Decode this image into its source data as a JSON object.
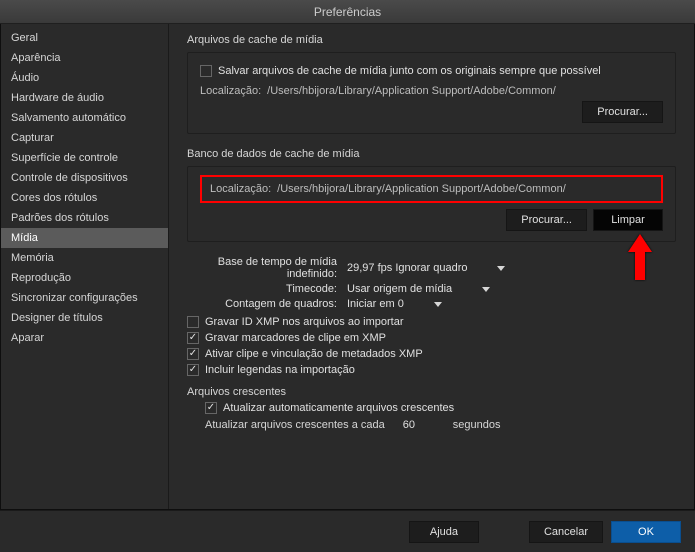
{
  "window": {
    "title": "Preferências"
  },
  "sidebar": {
    "items": [
      {
        "label": "Geral"
      },
      {
        "label": "Aparência"
      },
      {
        "label": "Áudio"
      },
      {
        "label": "Hardware de áudio"
      },
      {
        "label": "Salvamento automático"
      },
      {
        "label": "Capturar"
      },
      {
        "label": "Superfície de controle"
      },
      {
        "label": "Controle de dispositivos"
      },
      {
        "label": "Cores dos rótulos"
      },
      {
        "label": "Padrões dos rótulos"
      },
      {
        "label": "Mídia"
      },
      {
        "label": "Memória"
      },
      {
        "label": "Reprodução"
      },
      {
        "label": "Sincronizar configurações"
      },
      {
        "label": "Designer de títulos"
      },
      {
        "label": "Aparar"
      }
    ],
    "selected_index": 10
  },
  "media_cache": {
    "title": "Arquivos de cache de mídia",
    "save_with_originals": {
      "label": "Salvar arquivos de cache de mídia junto com os originais sempre que possível",
      "checked": false
    },
    "location_label": "Localização:",
    "location_path": "/Users/hbijora/Library/Application Support/Adobe/Common/",
    "browse": "Procurar..."
  },
  "media_db": {
    "title": "Banco de dados de cache de mídia",
    "location_label": "Localização:",
    "location_path": "/Users/hbijora/Library/Application Support/Adobe/Common/",
    "browse": "Procurar...",
    "clear": "Limpar"
  },
  "settings": {
    "timebase": {
      "label": "Base de tempo de mídia indefinido:",
      "value": "29,97 fps Ignorar quadro"
    },
    "timecode": {
      "label": "Timecode:",
      "value": "Usar origem de mídia"
    },
    "frame_count": {
      "label": "Contagem de quadros:",
      "value": "Iniciar em 0"
    },
    "write_xmp_id": {
      "label": "Gravar ID XMP nos arquivos ao importar",
      "checked": false
    },
    "write_markers_xmp": {
      "label": "Gravar marcadores de clipe em XMP",
      "checked": true
    },
    "enable_xmp_link": {
      "label": "Ativar clipe e vinculação de metadados XMP",
      "checked": true
    },
    "include_captions": {
      "label": "Incluir legendas na importação",
      "checked": true
    }
  },
  "growing": {
    "title": "Arquivos crescentes",
    "auto_refresh": {
      "label": "Atualizar automaticamente arquivos crescentes",
      "checked": true
    },
    "refresh_prefix": "Atualizar arquivos crescentes a cada",
    "refresh_value": "60",
    "refresh_suffix": "segundos"
  },
  "footer": {
    "help": "Ajuda",
    "cancel": "Cancelar",
    "ok": "OK"
  }
}
